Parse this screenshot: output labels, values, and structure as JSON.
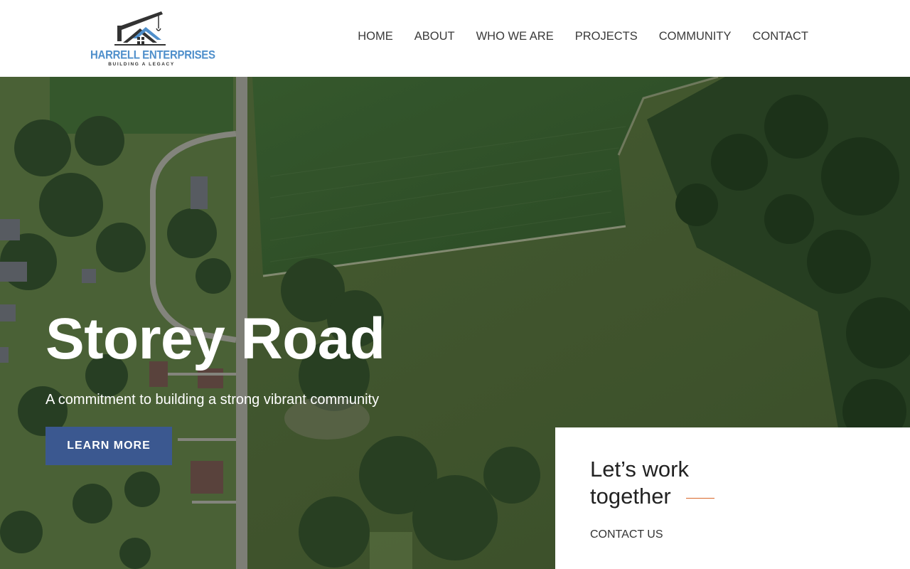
{
  "brand": {
    "name": "HARRELL ENTERPRISES",
    "tagline": "BUILDING A LEGACY",
    "accent": "#4f8fcb"
  },
  "nav": {
    "items": [
      {
        "label": "HOME"
      },
      {
        "label": "ABOUT"
      },
      {
        "label": "WHO WE ARE"
      },
      {
        "label": "PROJECTS"
      },
      {
        "label": "COMMUNITY"
      },
      {
        "label": "CONTACT"
      }
    ]
  },
  "hero": {
    "title": "Storey Road",
    "subtitle": "A commitment to building a strong vibrant community",
    "button_label": "LEARN MORE",
    "button_color": "#3b5890"
  },
  "contact_card": {
    "title": "Let’s work together",
    "link_label": "CONTACT US",
    "rule_color": "#d9672a"
  }
}
